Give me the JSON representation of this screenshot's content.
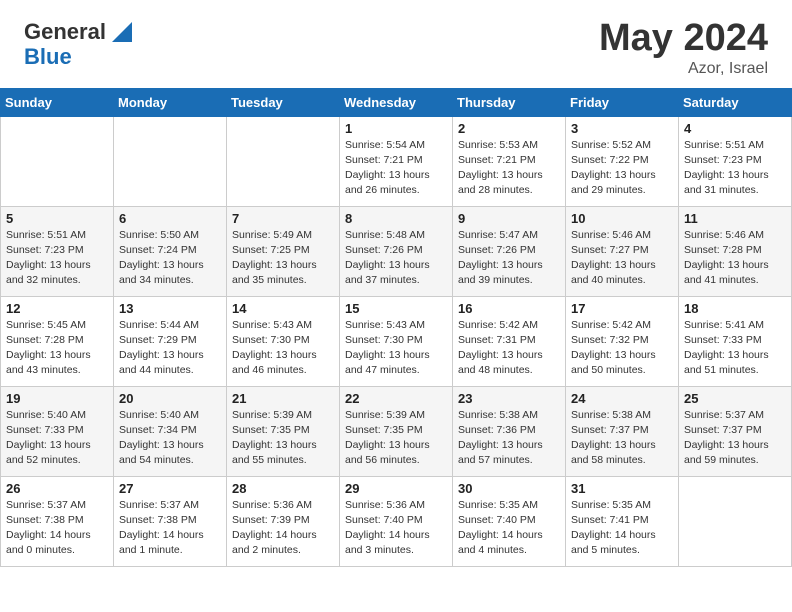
{
  "header": {
    "logo_general": "General",
    "logo_blue": "Blue",
    "month": "May 2024",
    "location": "Azor, Israel"
  },
  "days_of_week": [
    "Sunday",
    "Monday",
    "Tuesday",
    "Wednesday",
    "Thursday",
    "Friday",
    "Saturday"
  ],
  "weeks": [
    [
      {
        "day": "",
        "info": ""
      },
      {
        "day": "",
        "info": ""
      },
      {
        "day": "",
        "info": ""
      },
      {
        "day": "1",
        "info": "Sunrise: 5:54 AM\nSunset: 7:21 PM\nDaylight: 13 hours\nand 26 minutes."
      },
      {
        "day": "2",
        "info": "Sunrise: 5:53 AM\nSunset: 7:21 PM\nDaylight: 13 hours\nand 28 minutes."
      },
      {
        "day": "3",
        "info": "Sunrise: 5:52 AM\nSunset: 7:22 PM\nDaylight: 13 hours\nand 29 minutes."
      },
      {
        "day": "4",
        "info": "Sunrise: 5:51 AM\nSunset: 7:23 PM\nDaylight: 13 hours\nand 31 minutes."
      }
    ],
    [
      {
        "day": "5",
        "info": "Sunrise: 5:51 AM\nSunset: 7:23 PM\nDaylight: 13 hours\nand 32 minutes."
      },
      {
        "day": "6",
        "info": "Sunrise: 5:50 AM\nSunset: 7:24 PM\nDaylight: 13 hours\nand 34 minutes."
      },
      {
        "day": "7",
        "info": "Sunrise: 5:49 AM\nSunset: 7:25 PM\nDaylight: 13 hours\nand 35 minutes."
      },
      {
        "day": "8",
        "info": "Sunrise: 5:48 AM\nSunset: 7:26 PM\nDaylight: 13 hours\nand 37 minutes."
      },
      {
        "day": "9",
        "info": "Sunrise: 5:47 AM\nSunset: 7:26 PM\nDaylight: 13 hours\nand 39 minutes."
      },
      {
        "day": "10",
        "info": "Sunrise: 5:46 AM\nSunset: 7:27 PM\nDaylight: 13 hours\nand 40 minutes."
      },
      {
        "day": "11",
        "info": "Sunrise: 5:46 AM\nSunset: 7:28 PM\nDaylight: 13 hours\nand 41 minutes."
      }
    ],
    [
      {
        "day": "12",
        "info": "Sunrise: 5:45 AM\nSunset: 7:28 PM\nDaylight: 13 hours\nand 43 minutes."
      },
      {
        "day": "13",
        "info": "Sunrise: 5:44 AM\nSunset: 7:29 PM\nDaylight: 13 hours\nand 44 minutes."
      },
      {
        "day": "14",
        "info": "Sunrise: 5:43 AM\nSunset: 7:30 PM\nDaylight: 13 hours\nand 46 minutes."
      },
      {
        "day": "15",
        "info": "Sunrise: 5:43 AM\nSunset: 7:30 PM\nDaylight: 13 hours\nand 47 minutes."
      },
      {
        "day": "16",
        "info": "Sunrise: 5:42 AM\nSunset: 7:31 PM\nDaylight: 13 hours\nand 48 minutes."
      },
      {
        "day": "17",
        "info": "Sunrise: 5:42 AM\nSunset: 7:32 PM\nDaylight: 13 hours\nand 50 minutes."
      },
      {
        "day": "18",
        "info": "Sunrise: 5:41 AM\nSunset: 7:33 PM\nDaylight: 13 hours\nand 51 minutes."
      }
    ],
    [
      {
        "day": "19",
        "info": "Sunrise: 5:40 AM\nSunset: 7:33 PM\nDaylight: 13 hours\nand 52 minutes."
      },
      {
        "day": "20",
        "info": "Sunrise: 5:40 AM\nSunset: 7:34 PM\nDaylight: 13 hours\nand 54 minutes."
      },
      {
        "day": "21",
        "info": "Sunrise: 5:39 AM\nSunset: 7:35 PM\nDaylight: 13 hours\nand 55 minutes."
      },
      {
        "day": "22",
        "info": "Sunrise: 5:39 AM\nSunset: 7:35 PM\nDaylight: 13 hours\nand 56 minutes."
      },
      {
        "day": "23",
        "info": "Sunrise: 5:38 AM\nSunset: 7:36 PM\nDaylight: 13 hours\nand 57 minutes."
      },
      {
        "day": "24",
        "info": "Sunrise: 5:38 AM\nSunset: 7:37 PM\nDaylight: 13 hours\nand 58 minutes."
      },
      {
        "day": "25",
        "info": "Sunrise: 5:37 AM\nSunset: 7:37 PM\nDaylight: 13 hours\nand 59 minutes."
      }
    ],
    [
      {
        "day": "26",
        "info": "Sunrise: 5:37 AM\nSunset: 7:38 PM\nDaylight: 14 hours\nand 0 minutes."
      },
      {
        "day": "27",
        "info": "Sunrise: 5:37 AM\nSunset: 7:38 PM\nDaylight: 14 hours\nand 1 minute."
      },
      {
        "day": "28",
        "info": "Sunrise: 5:36 AM\nSunset: 7:39 PM\nDaylight: 14 hours\nand 2 minutes."
      },
      {
        "day": "29",
        "info": "Sunrise: 5:36 AM\nSunset: 7:40 PM\nDaylight: 14 hours\nand 3 minutes."
      },
      {
        "day": "30",
        "info": "Sunrise: 5:35 AM\nSunset: 7:40 PM\nDaylight: 14 hours\nand 4 minutes."
      },
      {
        "day": "31",
        "info": "Sunrise: 5:35 AM\nSunset: 7:41 PM\nDaylight: 14 hours\nand 5 minutes."
      },
      {
        "day": "",
        "info": ""
      }
    ]
  ]
}
